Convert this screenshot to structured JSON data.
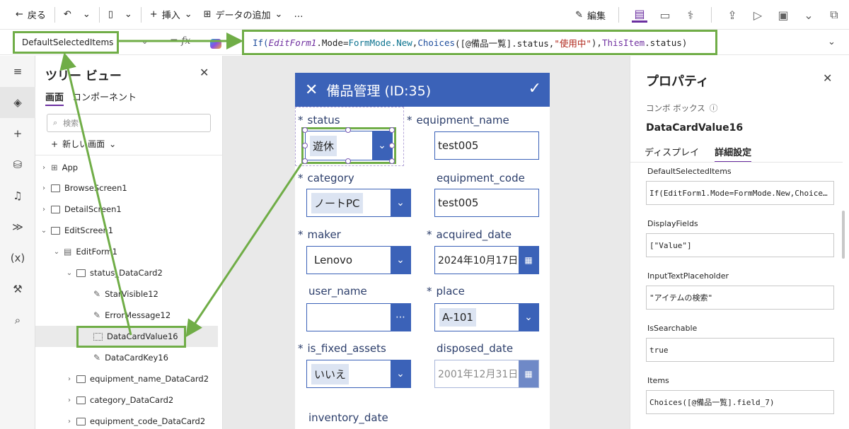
{
  "toolbar": {
    "back_label": "戻る",
    "insert_label": "挿入",
    "add_data_label": "データの追加",
    "more_label": "…",
    "edit_label": "編集"
  },
  "formula_bar": {
    "property": "DefaultSelectedItems",
    "fx_label": "fx",
    "formula_parts": [
      "If(",
      "EditForm1",
      ".Mode=",
      "FormMode.New",
      ",",
      "Choices",
      "([@備品一覧].status,",
      "\"使用中\"",
      "),",
      "ThisItem",
      ".status)"
    ]
  },
  "tree": {
    "title": "ツリー ビュー",
    "tabs": [
      "画面",
      "コンポーネント"
    ],
    "search_placeholder": "検索",
    "new_screen": "新しい画面",
    "items": [
      {
        "label": "App",
        "chevron": ">",
        "icon": "app-icon"
      },
      {
        "label": "BrowseScreen1",
        "chevron": ">",
        "icon": "screen-icon"
      },
      {
        "label": "DetailScreen1",
        "chevron": ">",
        "icon": "screen-icon"
      },
      {
        "label": "EditScreen1",
        "chevron": "v",
        "icon": "screen-icon"
      },
      {
        "label": "EditForm1",
        "chevron": "v",
        "icon": "form-icon"
      },
      {
        "label": "status_DataCard2",
        "chevron": "v",
        "icon": "card-icon"
      },
      {
        "label": "StarVisible12",
        "chevron": "",
        "icon": "edit-icon"
      },
      {
        "label": "ErrorMessage12",
        "chevron": "",
        "icon": "edit-icon"
      },
      {
        "label": "DataCardValue16",
        "chevron": "",
        "icon": "combobox-icon"
      },
      {
        "label": "DataCardKey16",
        "chevron": "",
        "icon": "edit-icon"
      },
      {
        "label": "equipment_name_DataCard2",
        "chevron": ">",
        "icon": "card-icon"
      },
      {
        "label": "category_DataCard2",
        "chevron": ">",
        "icon": "card-icon"
      },
      {
        "label": "equipment_code_DataCard2",
        "chevron": ">",
        "icon": "card-icon"
      }
    ]
  },
  "form": {
    "title": "備品管理 (ID:35)",
    "fields": {
      "status": {
        "label": "status",
        "value": "遊休"
      },
      "equipment_name": {
        "label": "equipment_name",
        "value": "test005"
      },
      "category": {
        "label": "category",
        "value": "ノートPC"
      },
      "equipment_code": {
        "label": "equipment_code",
        "value": "test005"
      },
      "maker": {
        "label": "maker",
        "value": "Lenovo"
      },
      "acquired_date": {
        "label": "acquired_date",
        "value": "2024年10月17日"
      },
      "user_name": {
        "label": "user_name",
        "value": ""
      },
      "place": {
        "label": "place",
        "value": "A-101"
      },
      "is_fixed_assets": {
        "label": "is_fixed_assets",
        "value": "いいえ"
      },
      "disposed_date": {
        "label": "disposed_date",
        "value": "2001年12月31日"
      },
      "inventory_date": {
        "label": "inventory_date"
      }
    },
    "required_mark": "*"
  },
  "properties": {
    "title": "プロパティ",
    "control_type": "コンボ ボックス",
    "control_name": "DataCardValue16",
    "tabs": [
      "ディスプレイ",
      "詳細設定"
    ],
    "items": [
      {
        "label": "DefaultSelectedItems",
        "value": "If(EditForm1.Mode=FormMode.New,Choice…"
      },
      {
        "label": "DisplayFields",
        "value": "[\"Value\"]"
      },
      {
        "label": "InputTextPlaceholder",
        "value": "\"アイテムの検索\""
      },
      {
        "label": "IsSearchable",
        "value": "true"
      },
      {
        "label": "Items",
        "value": "Choices([@備品一覧].field_7)"
      }
    ]
  },
  "colors": {
    "accent": "#3b62b8",
    "annotation": "#70ad47",
    "brand": "#6b2fa0"
  }
}
